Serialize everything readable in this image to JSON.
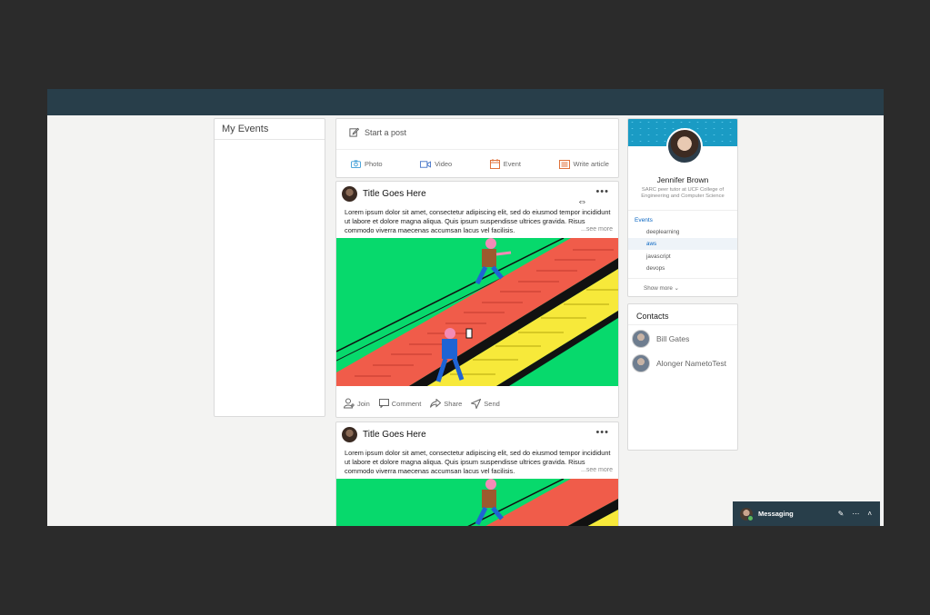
{
  "my_events": {
    "title": "My Events"
  },
  "composer": {
    "start_label": "Start a post",
    "actions": [
      {
        "label": "Photo",
        "icon": "camera-icon",
        "color": "#3a9bd6"
      },
      {
        "label": "Video",
        "icon": "video-icon",
        "color": "#4a78c9"
      },
      {
        "label": "Event",
        "icon": "calendar-icon",
        "color": "#e0733c"
      },
      {
        "label": "Write article",
        "icon": "article-icon",
        "color": "#e0733c"
      }
    ]
  },
  "posts": [
    {
      "title": "Title Goes Here",
      "body": "Lorem ipsum dolor sit amet, consectetur adipiscing elit, sed do eiusmod tempor incididunt ut labore et dolore magna aliqua. Quis ipsum suspendisse ultrices gravida. Risus commodo viverra maecenas accumsan lacus vel facilisis.",
      "see_more": "...see more",
      "more": "•••"
    },
    {
      "title": "Title Goes Here",
      "body": "Lorem ipsum dolor sit amet, consectetur adipiscing elit, sed do eiusmod tempor incididunt ut labore et dolore magna aliqua. Quis ipsum suspendisse ultrices gravida. Risus commodo viverra maecenas accumsan lacus vel facilisis.",
      "see_more": "...see more",
      "more": "•••"
    }
  ],
  "post_actions": [
    "Join",
    "Comment",
    "Share",
    "Send"
  ],
  "profile": {
    "name": "Jennifer Brown",
    "subtitle": "SARC peer tutor at UCF College of Engineering and Computer Science",
    "events_label": "Events",
    "events": [
      "deeplearning",
      "aws",
      "javascript",
      "devops"
    ],
    "active_event": "aws",
    "show_more": "Show more"
  },
  "contacts": {
    "title": "Contacts",
    "items": [
      "Bill Gates",
      "Alonger NametoTest"
    ]
  },
  "messaging": {
    "label": "Messaging"
  },
  "colors": {
    "topbar": "#283e4a",
    "accent": "#0a66c2",
    "image_green": "#07d96c",
    "stairs_red": "#f05c4a",
    "stairs_yellow": "#f7e93a"
  }
}
